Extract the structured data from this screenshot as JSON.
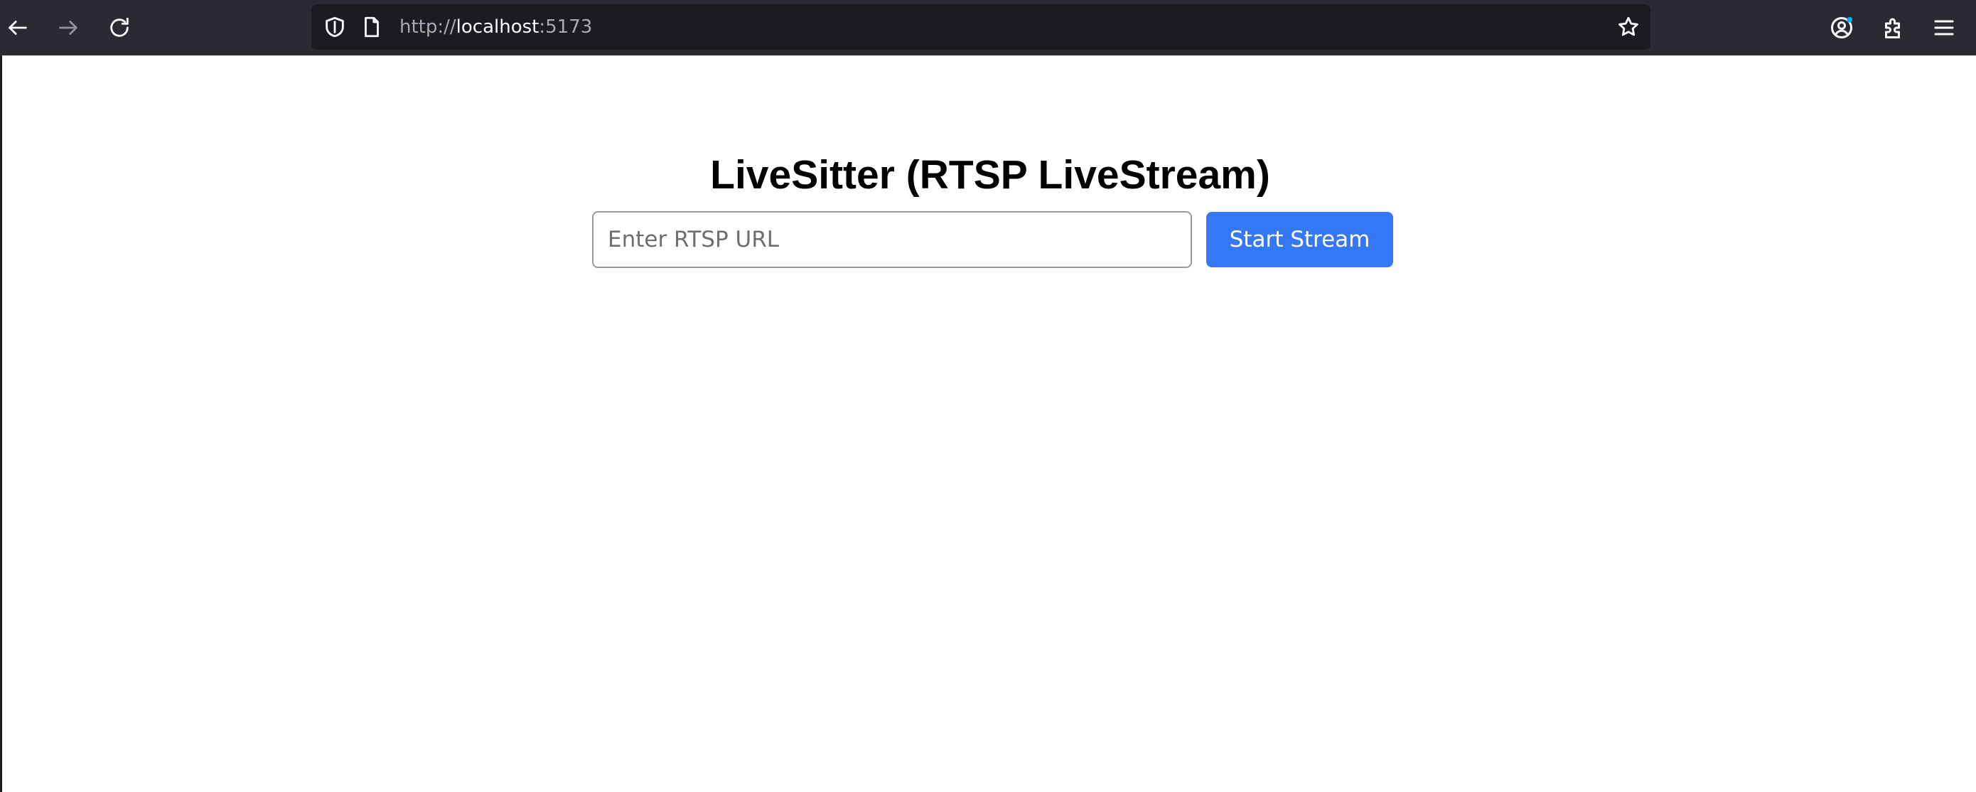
{
  "browser": {
    "url_scheme": "http://",
    "url_host": "localhost",
    "url_port": ":5173"
  },
  "page": {
    "title": "LiveSitter (RTSP LiveStream)",
    "rtsp_input": {
      "placeholder": "Enter RTSP URL",
      "value": ""
    },
    "start_button_label": "Start Stream",
    "accent_color": "#3478f6"
  }
}
